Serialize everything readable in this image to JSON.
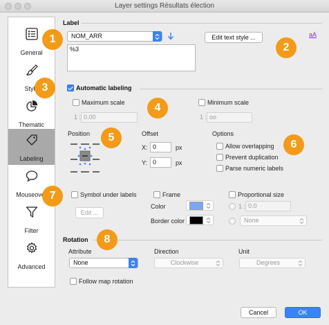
{
  "window": {
    "title": "Layer settings Résultats élection"
  },
  "sidebar": {
    "items": [
      {
        "label": "General",
        "icon": "list-icon"
      },
      {
        "label": "Style",
        "icon": "brush-icon"
      },
      {
        "label": "Thematic",
        "icon": "pie-chart-icon"
      },
      {
        "label": "Labeling",
        "icon": "tag-icon"
      },
      {
        "label": "Mouseover",
        "icon": "speech-bubble-icon"
      },
      {
        "label": "Filter",
        "icon": "funnel-icon"
      },
      {
        "label": "Advanced",
        "icon": "gear-icon"
      }
    ],
    "active": "Labeling"
  },
  "label_section": {
    "title": "Label",
    "field_select": "NOM_ARR",
    "expression": "%3",
    "edit_text_style_button": "Edit text style ...",
    "style_preview_glyph": "aA"
  },
  "automatic_labeling": {
    "title": "Automatic labeling",
    "checked": true,
    "max_scale": {
      "label": "Maximum scale",
      "prefix": "1 :",
      "value": "0.00"
    },
    "min_scale": {
      "label": "Minimum scale",
      "prefix": "1 :",
      "value": "oo"
    }
  },
  "position": {
    "title": "Position"
  },
  "offset": {
    "title": "Offset",
    "x_label": "X:",
    "x_value": "0",
    "y_label": "Y:",
    "y_value": "0",
    "unit": "px"
  },
  "options": {
    "title": "Options",
    "allow_overlapping": "Allow overlapping",
    "prevent_duplication": "Prevent duplication",
    "parse_numeric": "Parse numeric labels"
  },
  "symbol": {
    "symbol_under_labels": "Symbol under labels",
    "edit_button": "Edit ...",
    "frame": "Frame",
    "color_label": "Color",
    "border_color_label": "Border color",
    "frame_color": "#7aa7f0",
    "frame_border_color": "#000000",
    "proportional_size": "Proportional size",
    "prop_prefix": "1 :",
    "prop_value": "0.0",
    "none_select": "None"
  },
  "rotation": {
    "title": "Rotation",
    "attribute_label": "Attribute",
    "attribute_value": "None",
    "direction_label": "Direction",
    "direction_value": "Clockwise",
    "unit_label": "Unit",
    "unit_value": "Degrees",
    "follow_map": "Follow map rotation"
  },
  "footer": {
    "cancel": "Cancel",
    "ok": "OK"
  },
  "callouts": [
    "1",
    "2",
    "3",
    "4",
    "5",
    "6",
    "7",
    "8"
  ],
  "colors": {
    "accent": "#3b82f6",
    "callout": "#f39a18",
    "sidebar_active": "#a9a9a9"
  }
}
